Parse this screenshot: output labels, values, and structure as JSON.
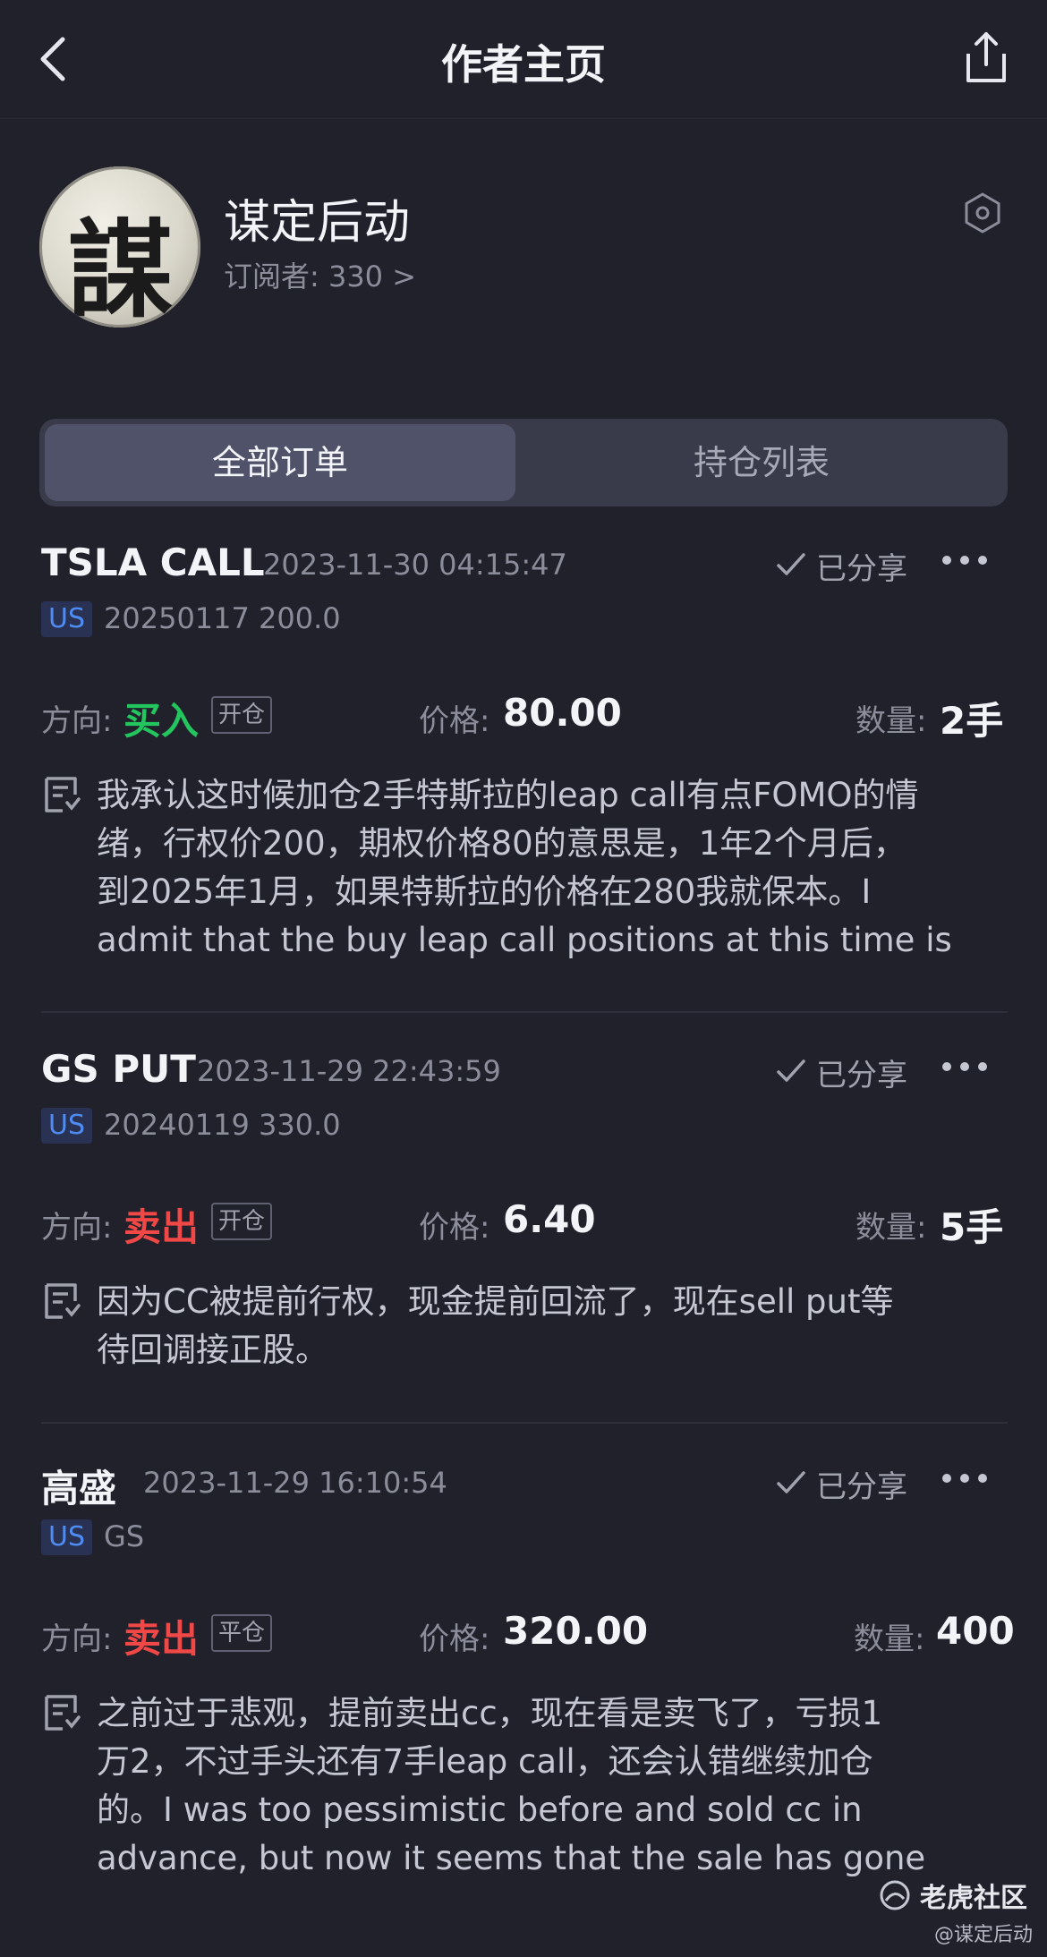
{
  "header": {
    "title": "作者主页"
  },
  "profile": {
    "avatar_char": "謀",
    "name": "谋定后动",
    "subscribers": "订阅者: 330 >"
  },
  "tabs": [
    {
      "label": "全部订单",
      "active": true
    },
    {
      "label": "持仓列表",
      "active": false
    }
  ],
  "labels": {
    "direction": "方向:",
    "price": "价格:",
    "quantity": "数量:",
    "shared": "已分享",
    "market": "US"
  },
  "orders": [
    {
      "title": "TSLA CALL",
      "time": "2023-11-30 04:15:47",
      "code": "20250117 200.0",
      "direction": "买入",
      "direction_type": "buy",
      "position": "开仓",
      "price": "80.00",
      "quantity": "2手",
      "note": "我承认这时候加仓2手特斯拉的leap call有点FOMO的情\n绪，行权价200，期权价格80的意思是，1年2个月后，\n到2025年1月，如果特斯拉的价格在280我就保本。I\nadmit that the buy leap call positions at this time is a..."
    },
    {
      "title": "GS PUT",
      "time": "2023-11-29 22:43:59",
      "code": "20240119 330.0",
      "direction": "卖出",
      "direction_type": "sell",
      "position": "开仓",
      "price": "6.40",
      "quantity": "5手",
      "note": "因为CC被提前行权，现金提前回流了，现在sell put等\n待回调接正股。"
    },
    {
      "title": "高盛",
      "time": "2023-11-29 16:10:54",
      "code": "GS",
      "direction": "卖出",
      "direction_type": "sell",
      "position": "平仓",
      "price": "320.00",
      "quantity": "400",
      "note": "之前过于悲观，提前卖出cc，现在看是卖飞了，亏损1\n万2，不过手头还有7手leap call，还会认错继续加仓\n的。I was too pessimistic before and sold cc in\nadvance, but now it seems that the sale has gone too..."
    }
  ],
  "watermark": {
    "brand": "老虎社区",
    "user": "@谋定后动"
  },
  "colors": {
    "background": "#20212b",
    "buy": "#22c55e",
    "sell": "#f04747",
    "market_badge": "#4e8cf4"
  }
}
